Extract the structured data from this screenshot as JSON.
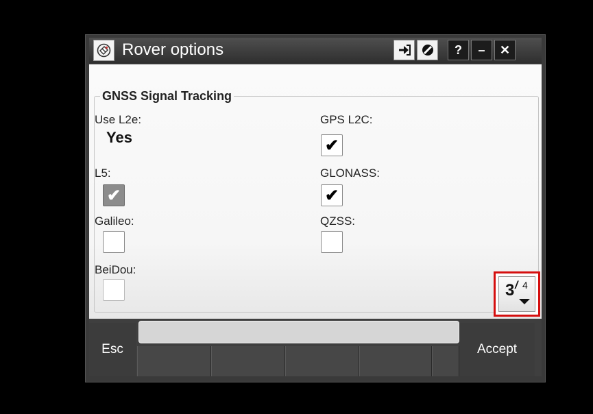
{
  "window": {
    "title": "Rover options",
    "app_icon": "satellite-icon",
    "title_buttons": [
      {
        "icon": "login-arrow-icon",
        "label": "➔"
      },
      {
        "icon": "no-entry-icon",
        "label": "⊘"
      },
      {
        "icon": "help-icon",
        "label": "?"
      },
      {
        "icon": "minimize-icon",
        "label": "–"
      },
      {
        "icon": "close-icon",
        "label": "✕"
      }
    ]
  },
  "group": {
    "title": "GNSS Signal Tracking"
  },
  "fields": {
    "use_l2e": {
      "label": "Use L2e:",
      "value": "Yes"
    },
    "gps_l2c": {
      "label": "GPS L2C:",
      "checked": true
    },
    "l5": {
      "label": "L5:",
      "checked": true,
      "disabled": true
    },
    "glonass": {
      "label": "GLONASS:",
      "checked": true
    },
    "galileo": {
      "label": "Galileo:",
      "checked": false
    },
    "qzss": {
      "label": "QZSS:",
      "checked": false
    },
    "beidou": {
      "label": "BeiDou:",
      "checked": false,
      "disabled": true
    }
  },
  "check_glyph": "✔",
  "pager": {
    "current": "3",
    "separator": "/",
    "total": "4",
    "icon": "chevron-down-icon"
  },
  "bottom": {
    "esc_label": "Esc",
    "accept_label": "Accept"
  },
  "colors": {
    "highlight": "#d50f0f"
  }
}
